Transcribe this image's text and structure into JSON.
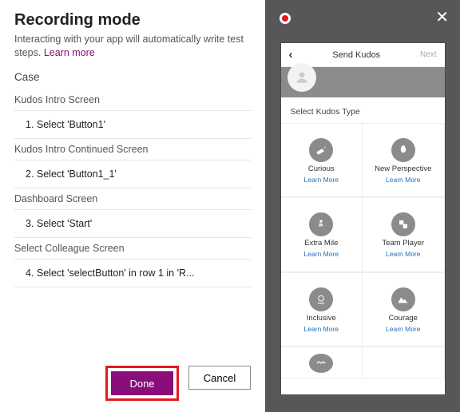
{
  "left": {
    "title": "Recording mode",
    "subtitle_a": "Interacting with your app will automatically write test steps. ",
    "learn_more": "Learn more",
    "case_label": "Case",
    "sections": {
      "s1_title": "Kudos Intro Screen",
      "s1_step": "1.  Select 'Button1'",
      "s2_title": "Kudos Intro Continued Screen",
      "s2_step": "2.  Select 'Button1_1'",
      "s3_title": "Dashboard Screen",
      "s3_step": "3.  Select 'Start'",
      "s4_title": "Select Colleague Screen",
      "s4_step": "4.  Select 'selectButton' in row 1 in 'R..."
    },
    "done": "Done",
    "cancel": "Cancel"
  },
  "phone": {
    "header_title": "Send Kudos",
    "header_next": "Next",
    "select_label": "Select Kudos Type",
    "learn_more": "Learn More",
    "k1": "Curious",
    "k2": "New Perspective",
    "k3": "Extra Mile",
    "k4": "Team Player",
    "k5": "Inclusive",
    "k6": "Courage"
  }
}
